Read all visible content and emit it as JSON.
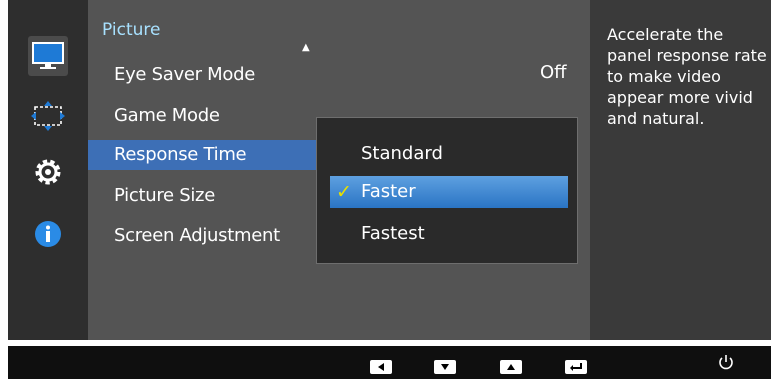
{
  "panel": {
    "title": "Picture",
    "items": [
      {
        "label": "Eye Saver Mode",
        "value": "Off"
      },
      {
        "label": "Game Mode"
      },
      {
        "label": "Response Time"
      },
      {
        "label": "Picture Size"
      },
      {
        "label": "Screen Adjustment"
      }
    ]
  },
  "dropdown": {
    "options": [
      "Standard",
      "Faster",
      "Fastest"
    ],
    "selected": "Faster"
  },
  "help": {
    "text": "Accelerate the panel response rate to make video appear more vivid and natural."
  },
  "sidebar": {
    "icons": [
      "monitor-icon",
      "screen-size-icon",
      "gear-icon",
      "info-icon"
    ],
    "selected": "monitor-icon"
  },
  "bottombar": {
    "icons": [
      "left-arrow-icon",
      "down-arrow-icon",
      "up-arrow-icon",
      "enter-icon",
      "power-icon"
    ]
  },
  "colors": {
    "panel_title": "#a8e1ff",
    "selection": "#3d6fb6",
    "check": "#e8e000"
  }
}
